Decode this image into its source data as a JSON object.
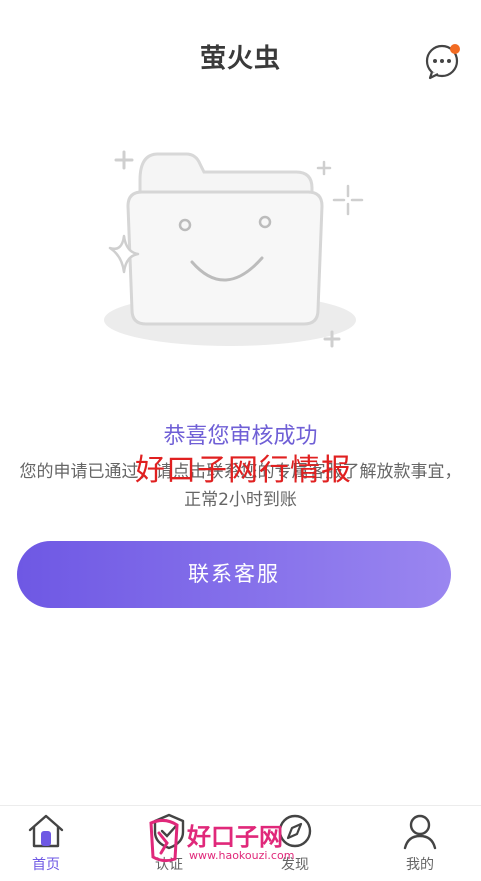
{
  "header": {
    "title": "萤火虫"
  },
  "status": {
    "title": "恭喜您审核成功",
    "description": "您的申请已通过，请点击联系您的专属客服了解放款事宜，正常2小时到账"
  },
  "watermark": {
    "text": "好口子网行情报",
    "logo_text": "好口子网",
    "logo_url": "www.haokouzi.com"
  },
  "actions": {
    "contact_label": "联系客服"
  },
  "tabbar": {
    "items": [
      {
        "label": "首页",
        "icon": "home-icon",
        "active": true
      },
      {
        "label": "认证",
        "icon": "shield-icon",
        "active": false
      },
      {
        "label": "发现",
        "icon": "compass-icon",
        "active": false
      },
      {
        "label": "我的",
        "icon": "user-icon",
        "active": false
      }
    ]
  },
  "colors": {
    "accent": "#6e58e4",
    "accent_light": "#9a86f0",
    "notification_dot": "#f26b22",
    "watermark_red": "#e02020",
    "watermark_pink": "#e0287a"
  }
}
